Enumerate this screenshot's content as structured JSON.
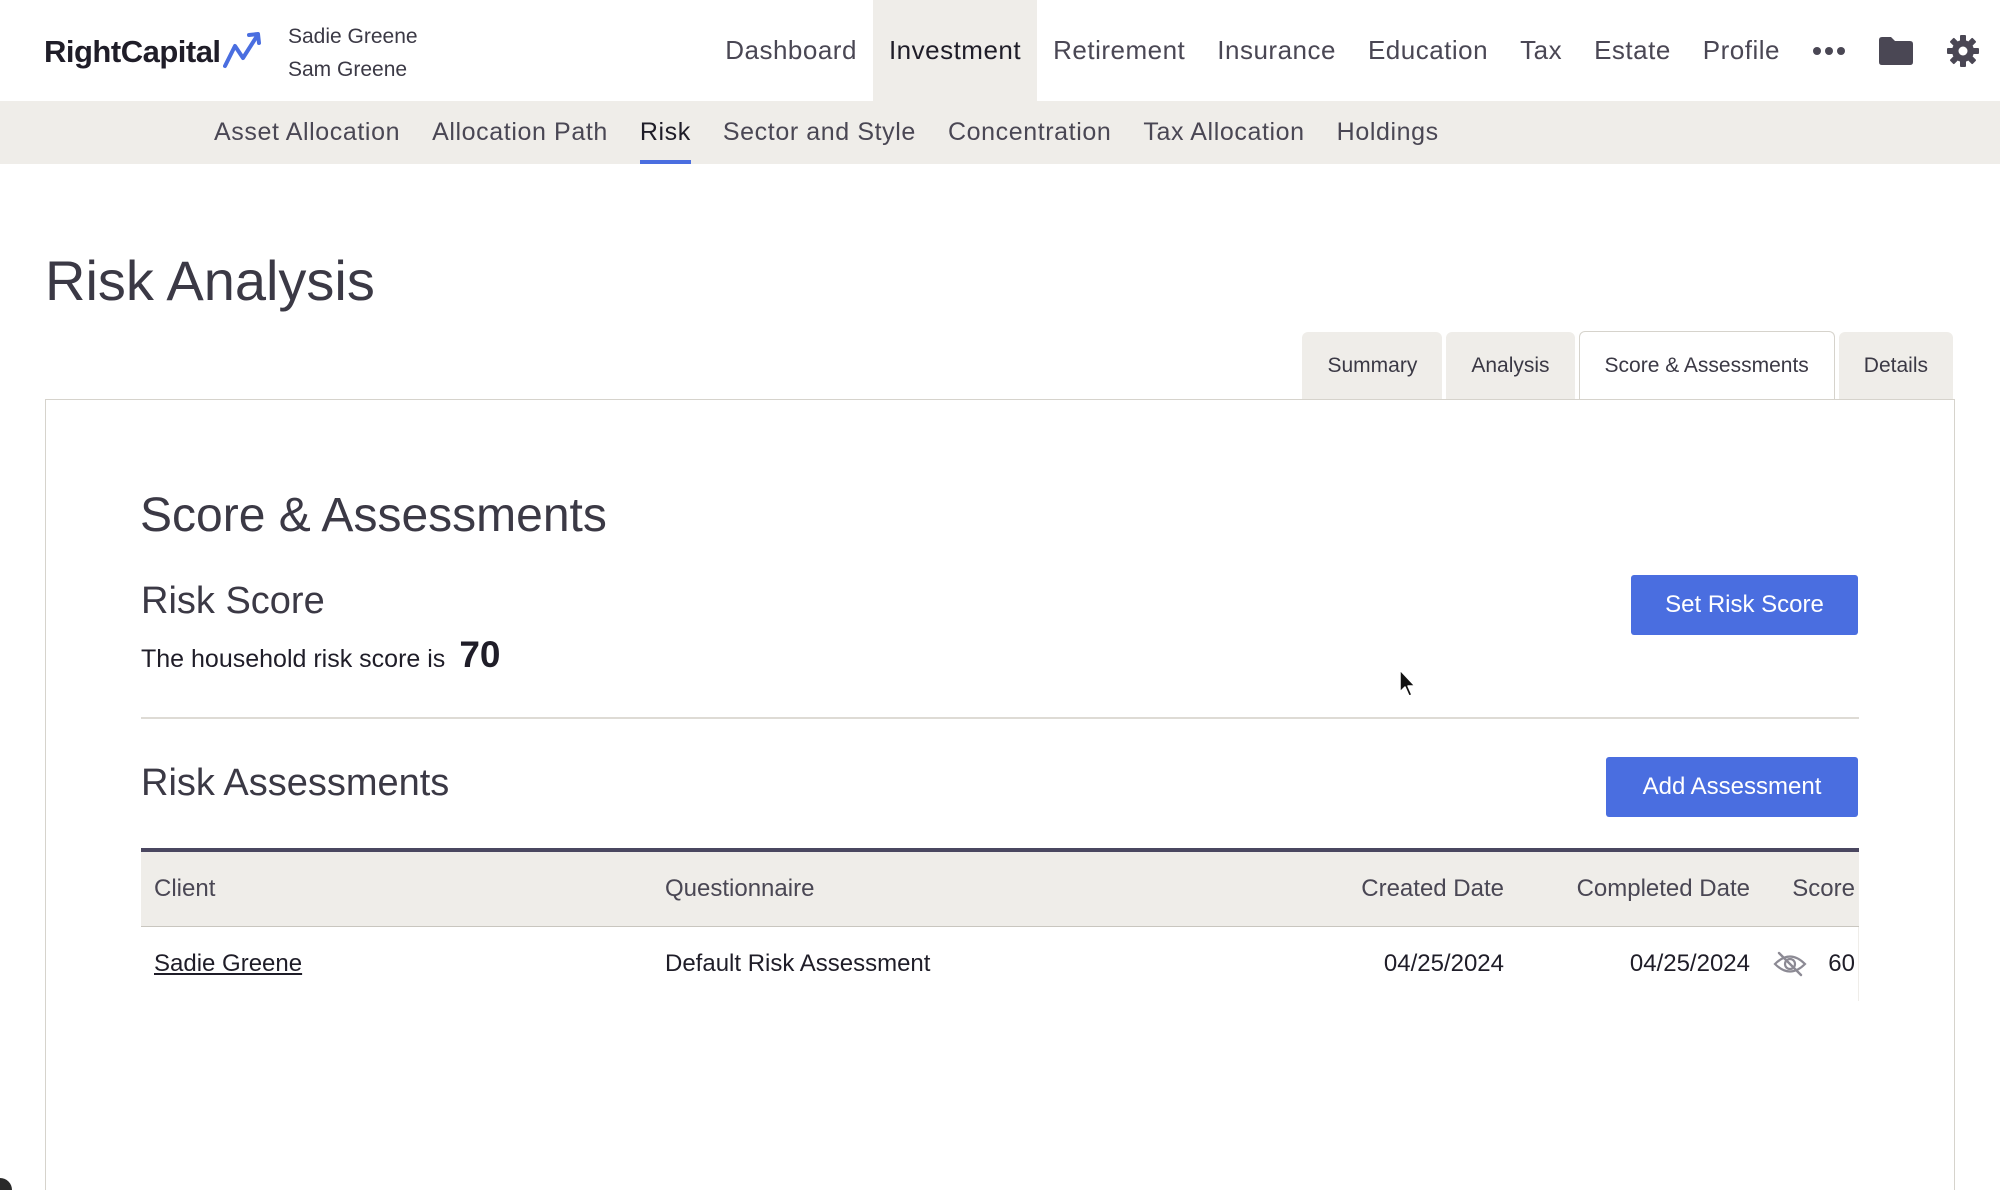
{
  "app": {
    "logo_text": "RightCapital",
    "household": [
      "Sadie Greene",
      "Sam Greene"
    ]
  },
  "main_nav": {
    "items": [
      "Dashboard",
      "Investment",
      "Retirement",
      "Insurance",
      "Education",
      "Tax",
      "Estate",
      "Profile"
    ],
    "active": "Investment",
    "icons": [
      "more-icon",
      "folder-icon",
      "gear-icon"
    ]
  },
  "sub_nav": {
    "items": [
      "Asset Allocation",
      "Allocation Path",
      "Risk",
      "Sector and Style",
      "Concentration",
      "Tax Allocation",
      "Holdings"
    ],
    "active": "Risk"
  },
  "page": {
    "title": "Risk Analysis",
    "tabs": [
      "Summary",
      "Analysis",
      "Score & Assessments",
      "Details"
    ],
    "active_tab": "Score & Assessments"
  },
  "score_section": {
    "title": "Score & Assessments",
    "risk_score_heading": "Risk Score",
    "risk_score_text": "The household risk score is",
    "risk_score_value": "70",
    "set_button": "Set Risk Score"
  },
  "assessments": {
    "heading": "Risk Assessments",
    "add_button": "Add Assessment",
    "columns": [
      "Client",
      "Questionnaire",
      "Created Date",
      "Completed Date",
      "Score"
    ],
    "rows": [
      {
        "client": "Sadie Greene",
        "questionnaire": "Default Risk Assessment",
        "created": "04/25/2024",
        "completed": "04/25/2024",
        "score": "60",
        "action_icon": "eye-off-icon"
      }
    ]
  },
  "colors": {
    "accent": "#4a6ee0",
    "nav_bg": "#efede9",
    "text": "#3b3945",
    "table_top_border": "#4a4760"
  }
}
